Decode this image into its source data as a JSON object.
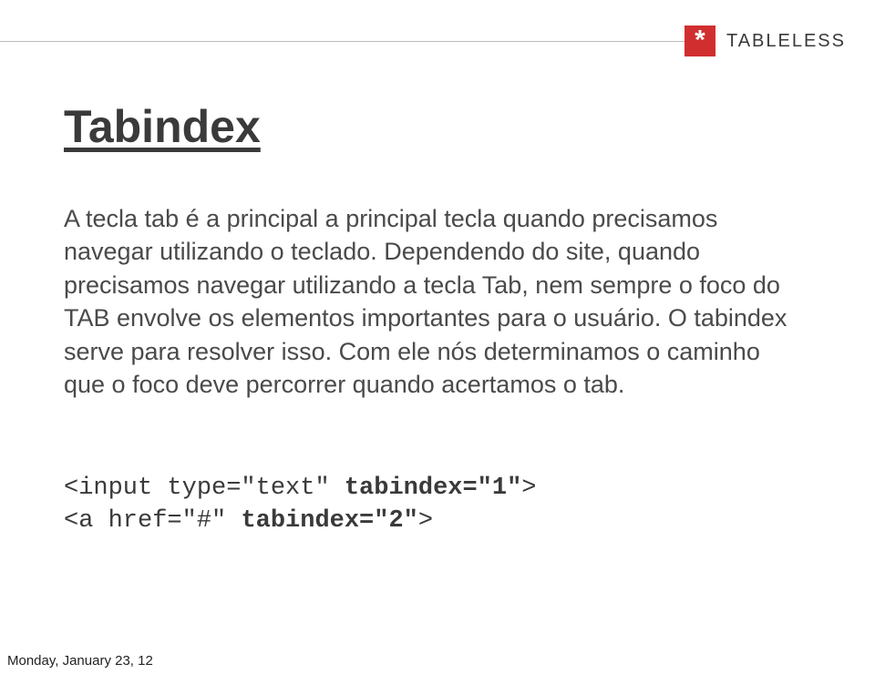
{
  "header": {
    "brand": "TABLELESS",
    "asterisk": "*"
  },
  "heading": "Tabindex",
  "paragraph": "A tecla tab é a principal a principal tecla quando precisamos navegar utilizando o teclado. Dependendo do site, quando precisamos navegar utilizando a tecla Tab, nem sempre o foco do TAB envolve os elementos importantes para o usuário. O tabindex serve para resolver isso. Com ele nós determinamos o caminho que o foco deve percorrer quando acertamos o tab.",
  "code": {
    "line1_prefix": "<input type=\"text\" ",
    "line1_bold": "tabindex=\"1\"",
    "line1_suffix": ">",
    "line2_prefix": "<a href=\"#\" ",
    "line2_bold": "tabindex=\"2\"",
    "line2_suffix": ">"
  },
  "footer": "Monday, January 23, 12"
}
